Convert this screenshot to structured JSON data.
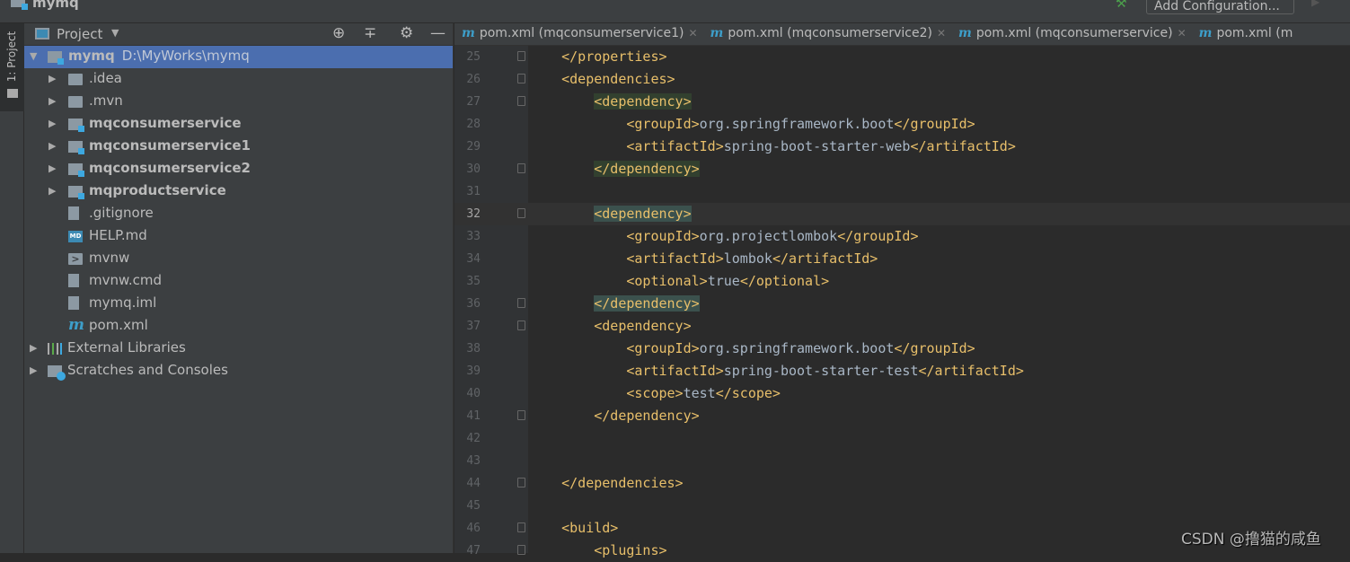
{
  "window": {
    "title": "mymq",
    "add_configuration": "Add Configuration..."
  },
  "stripe": {
    "project_tab": "1: Project"
  },
  "panel": {
    "title": "Project"
  },
  "tree": [
    {
      "label": "mymq",
      "path": "D:\\MyWorks\\mymq",
      "icon": "module",
      "depth": 0,
      "expanded": true,
      "bold": true,
      "selected": true
    },
    {
      "label": ".idea",
      "icon": "folder",
      "depth": 1,
      "expanded": false
    },
    {
      "label": ".mvn",
      "icon": "folder",
      "depth": 1,
      "expanded": false
    },
    {
      "label": "mqconsumerservice",
      "icon": "module",
      "depth": 1,
      "expanded": false,
      "bold": true
    },
    {
      "label": "mqconsumerservice1",
      "icon": "module",
      "depth": 1,
      "expanded": false,
      "bold": true
    },
    {
      "label": "mqconsumerservice2",
      "icon": "module",
      "depth": 1,
      "expanded": false,
      "bold": true
    },
    {
      "label": "mqproductservice",
      "icon": "module",
      "depth": 1,
      "expanded": false,
      "bold": true
    },
    {
      "label": ".gitignore",
      "icon": "file",
      "depth": 1
    },
    {
      "label": "HELP.md",
      "icon": "markdown",
      "depth": 1
    },
    {
      "label": "mvnw",
      "icon": "shell",
      "depth": 1
    },
    {
      "label": "mvnw.cmd",
      "icon": "file",
      "depth": 1
    },
    {
      "label": "mymq.iml",
      "icon": "file",
      "depth": 1
    },
    {
      "label": "pom.xml",
      "icon": "maven",
      "depth": 1
    },
    {
      "label": "External Libraries",
      "icon": "libraries",
      "depth": 0,
      "expanded": false
    },
    {
      "label": "Scratches and Consoles",
      "icon": "scratches",
      "depth": 0,
      "expanded": false
    }
  ],
  "tabs": [
    {
      "label": "pom.xml (mqconsumerservice1)"
    },
    {
      "label": "pom.xml (mqconsumerservice2)"
    },
    {
      "label": "pom.xml (mqconsumerservice)"
    },
    {
      "label": "pom.xml (m"
    }
  ],
  "editor": {
    "current_line": 32,
    "lines": [
      {
        "n": 25,
        "indent": 1,
        "text": "</properties>",
        "fold": true
      },
      {
        "n": 26,
        "indent": 1,
        "text": "<dependencies>",
        "fold": true
      },
      {
        "n": 27,
        "indent": 2,
        "text": "<dependency>",
        "fold": true,
        "hl": 1
      },
      {
        "n": 28,
        "indent": 3,
        "text": "<groupId>org.springframework.boot</groupId>"
      },
      {
        "n": 29,
        "indent": 3,
        "text": "<artifactId>spring-boot-starter-web</artifactId>"
      },
      {
        "n": 30,
        "indent": 2,
        "text": "</dependency>",
        "fold": true,
        "hl": 1
      },
      {
        "n": 31,
        "indent": 0,
        "text": ""
      },
      {
        "n": 32,
        "indent": 2,
        "text": "<dependency>",
        "fold": true,
        "hl": 2
      },
      {
        "n": 33,
        "indent": 3,
        "text": "<groupId>org.projectlombok</groupId>"
      },
      {
        "n": 34,
        "indent": 3,
        "text": "<artifactId>lombok</artifactId>"
      },
      {
        "n": 35,
        "indent": 3,
        "text": "<optional>true</optional>"
      },
      {
        "n": 36,
        "indent": 2,
        "text": "</dependency>",
        "fold": true,
        "hl": 2
      },
      {
        "n": 37,
        "indent": 2,
        "text": "<dependency>",
        "fold": true
      },
      {
        "n": 38,
        "indent": 3,
        "text": "<groupId>org.springframework.boot</groupId>"
      },
      {
        "n": 39,
        "indent": 3,
        "text": "<artifactId>spring-boot-starter-test</artifactId>"
      },
      {
        "n": 40,
        "indent": 3,
        "text": "<scope>test</scope>"
      },
      {
        "n": 41,
        "indent": 2,
        "text": "</dependency>",
        "fold": true
      },
      {
        "n": 42,
        "indent": 0,
        "text": ""
      },
      {
        "n": 43,
        "indent": 0,
        "text": ""
      },
      {
        "n": 44,
        "indent": 1,
        "text": "</dependencies>",
        "fold": true
      },
      {
        "n": 45,
        "indent": 0,
        "text": ""
      },
      {
        "n": 46,
        "indent": 1,
        "text": "<build>",
        "fold": true
      },
      {
        "n": 47,
        "indent": 2,
        "text": "<plugins>",
        "fold": true
      }
    ]
  },
  "watermark": "CSDN @撸猫的咸鱼",
  "colors": {
    "tag": "#e8bf6a",
    "text": "#a9b7c6",
    "background": "#2b2b2b",
    "selection": "#4b6eaf",
    "maven": "#3d9ec9"
  }
}
